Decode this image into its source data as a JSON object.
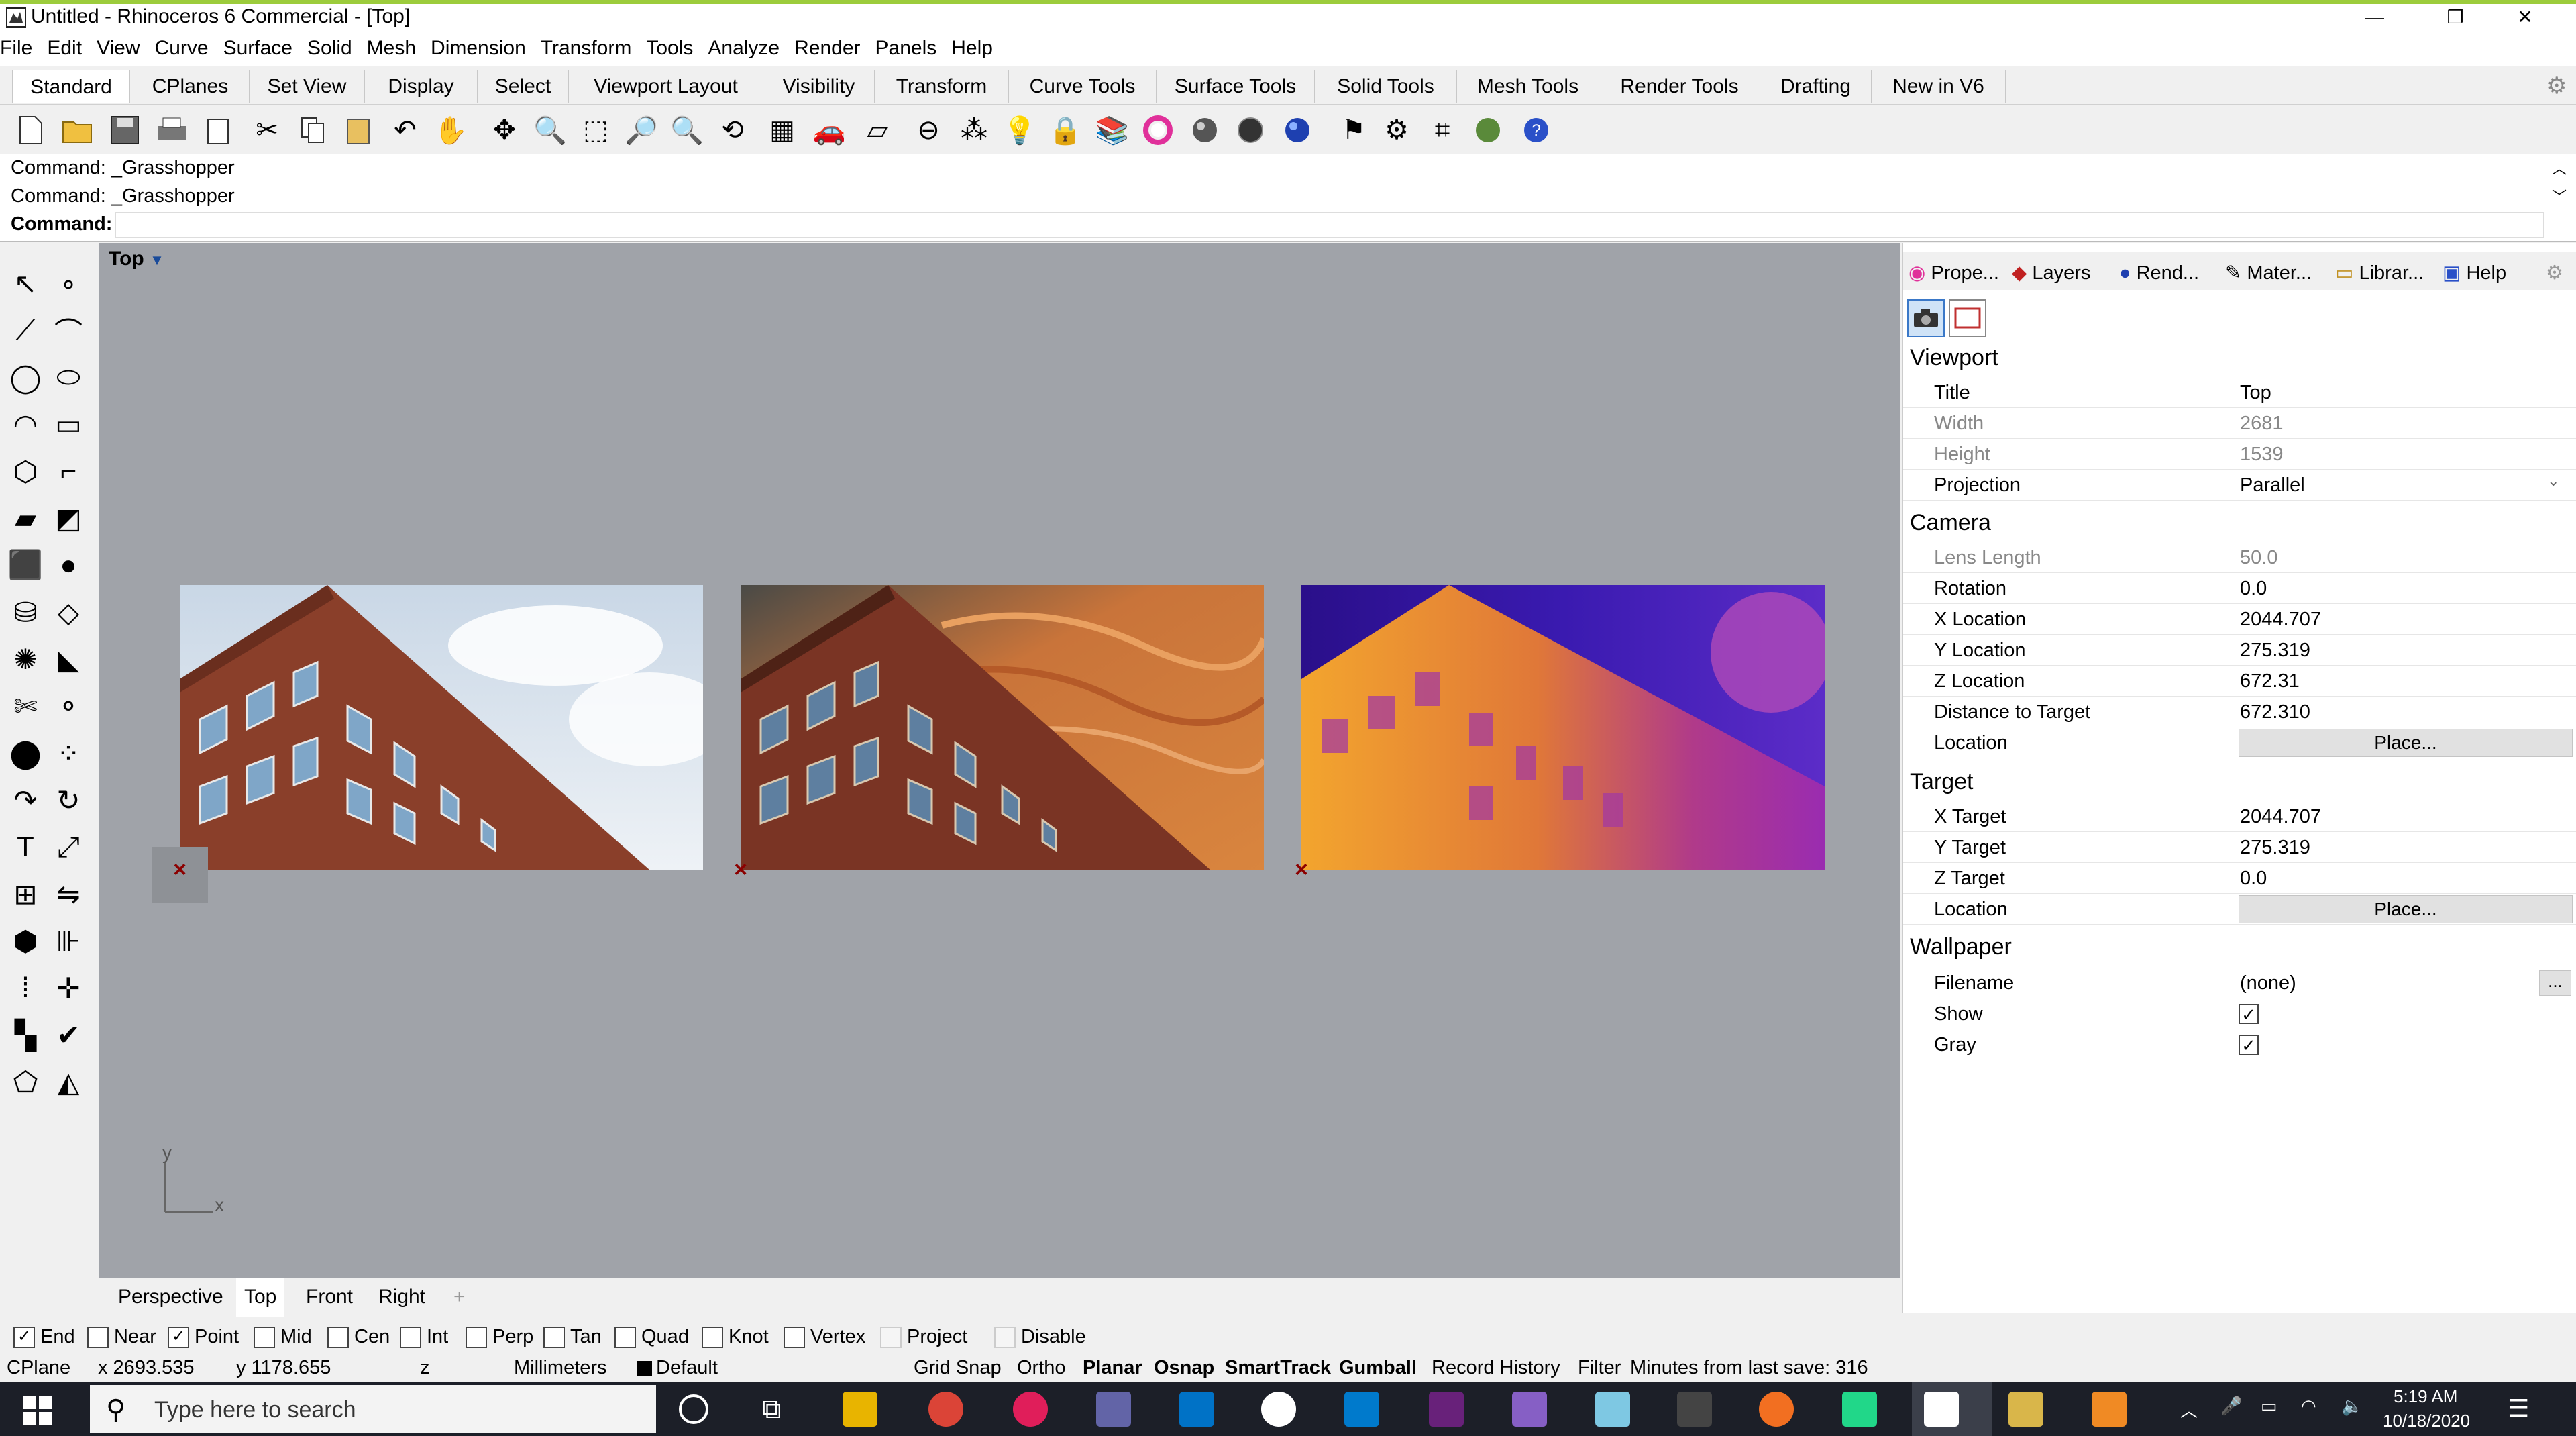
{
  "window": {
    "title": "Untitled - Rhinoceros 6 Commercial - [Top]",
    "controls": [
      "—",
      "❐",
      "✕"
    ]
  },
  "menu": [
    "File",
    "Edit",
    "View",
    "Curve",
    "Surface",
    "Solid",
    "Mesh",
    "Dimension",
    "Transform",
    "Tools",
    "Analyze",
    "Render",
    "Panels",
    "Help"
  ],
  "toolbar_tabs": [
    "Standard",
    "CPlanes",
    "Set View",
    "Display",
    "Select",
    "Viewport Layout",
    "Visibility",
    "Transform",
    "Curve Tools",
    "Surface Tools",
    "Solid Tools",
    "Mesh Tools",
    "Render Tools",
    "Drafting",
    "New in V6"
  ],
  "command": {
    "history": [
      "Command: _Grasshopper",
      "Command: _Grasshopper"
    ],
    "prompt": "Command:"
  },
  "viewport": {
    "name": "Top",
    "axis_x": "x",
    "axis_y": "y",
    "tabs": [
      "Perspective",
      "Top",
      "Front",
      "Right"
    ],
    "add_tab": "+"
  },
  "panel": {
    "tabs": [
      "Prope...",
      "Layers",
      "Rend...",
      "Mater...",
      "Librar...",
      "Help"
    ],
    "viewport_section": "Viewport",
    "viewport_rows": [
      {
        "label": "Title",
        "value": "Top"
      },
      {
        "label": "Width",
        "value": "2681"
      },
      {
        "label": "Height",
        "value": "1539"
      },
      {
        "label": "Projection",
        "value": "Parallel"
      }
    ],
    "camera_section": "Camera",
    "camera_rows": [
      {
        "label": "Lens Length",
        "value": "50.0"
      },
      {
        "label": "Rotation",
        "value": "0.0"
      },
      {
        "label": "X Location",
        "value": "2044.707"
      },
      {
        "label": "Y Location",
        "value": "275.319"
      },
      {
        "label": "Z Location",
        "value": "672.31"
      },
      {
        "label": "Distance to Target",
        "value": "672.310"
      },
      {
        "label": "Location",
        "value": "Place..."
      }
    ],
    "target_section": "Target",
    "target_rows": [
      {
        "label": "X Target",
        "value": "2044.707"
      },
      {
        "label": "Y Target",
        "value": "275.319"
      },
      {
        "label": "Z Target",
        "value": "0.0"
      },
      {
        "label": "Location",
        "value": "Place..."
      }
    ],
    "wallpaper_section": "Wallpaper",
    "wallpaper_rows": [
      {
        "label": "Filename",
        "value": "(none)"
      },
      {
        "label": "Show",
        "checked": true
      },
      {
        "label": "Gray",
        "checked": true
      }
    ],
    "browse": "..."
  },
  "osnap": [
    "End",
    "Near",
    "Point",
    "Mid",
    "Cen",
    "Int",
    "Perp",
    "Tan",
    "Quad",
    "Knot",
    "Vertex",
    "Project",
    "Disable"
  ],
  "osnap_checked": {
    "End": true,
    "Point": true
  },
  "status": {
    "cplane": "CPlane",
    "x": "x 2693.535",
    "y": "y 1178.655",
    "z": "z",
    "units": "Millimeters",
    "layer": "Default",
    "grid_snap": "Grid Snap",
    "ortho": "Ortho",
    "planar": "Planar",
    "osnap": "Osnap",
    "smarttrack": "SmartTrack",
    "gumball": "Gumball",
    "record_history": "Record History",
    "filter": "Filter",
    "save_info": "Minutes from last save: 316"
  },
  "taskbar": {
    "search_placeholder": "Type here to search",
    "time": "5:19 AM",
    "date": "10/18/2020"
  },
  "colors": {
    "viewport_bg": "#a0a3a9",
    "title_accent": "#9ccc3c",
    "taskbar_bg": "#1c1f28"
  }
}
